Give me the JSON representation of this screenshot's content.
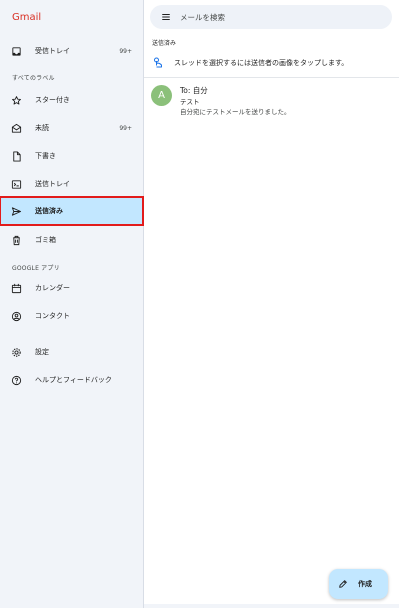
{
  "app": {
    "title": "Gmail"
  },
  "drawer": {
    "all_labels_header": "すべてのラベル",
    "google_apps_header": "GOOGLE アプリ",
    "items": [
      {
        "label": "受信トレイ",
        "count": "99+",
        "icon": "inbox-icon"
      },
      {
        "label": "スター付き",
        "count": "",
        "icon": "star-icon"
      },
      {
        "label": "未読",
        "count": "99+",
        "icon": "mail-icon"
      },
      {
        "label": "下書き",
        "count": "",
        "icon": "draft-icon"
      },
      {
        "label": "送信トレイ",
        "count": "",
        "icon": "outbox-icon"
      },
      {
        "label": "送信済み",
        "count": "",
        "icon": "send-icon",
        "selected": true
      },
      {
        "label": "ゴミ箱",
        "count": "",
        "icon": "trash-icon"
      },
      {
        "label": "カレンダー",
        "count": "",
        "icon": "calendar-icon"
      },
      {
        "label": "コンタクト",
        "count": "",
        "icon": "contact-icon"
      },
      {
        "label": "設定",
        "count": "",
        "icon": "gear-icon"
      },
      {
        "label": "ヘルプとフィードバック",
        "count": "",
        "icon": "help-icon"
      }
    ]
  },
  "search": {
    "placeholder": "メールを検索"
  },
  "main": {
    "folder_title": "送信済み",
    "tip": "スレッドを選択するには送信者の画像をタップします。",
    "messages": [
      {
        "avatar": "A",
        "to": "To: 自分",
        "subject": "テスト",
        "snippet": "自分宛にテストメールを送りました。"
      }
    ]
  },
  "fab": {
    "label": "作成"
  },
  "colors": {
    "brand_red": "#d93025",
    "selected_bg": "#c2e7ff",
    "highlight_outline": "#e21b1b",
    "drawer_bg": "#f1f4f9",
    "avatar_bg": "#8bc07a"
  }
}
